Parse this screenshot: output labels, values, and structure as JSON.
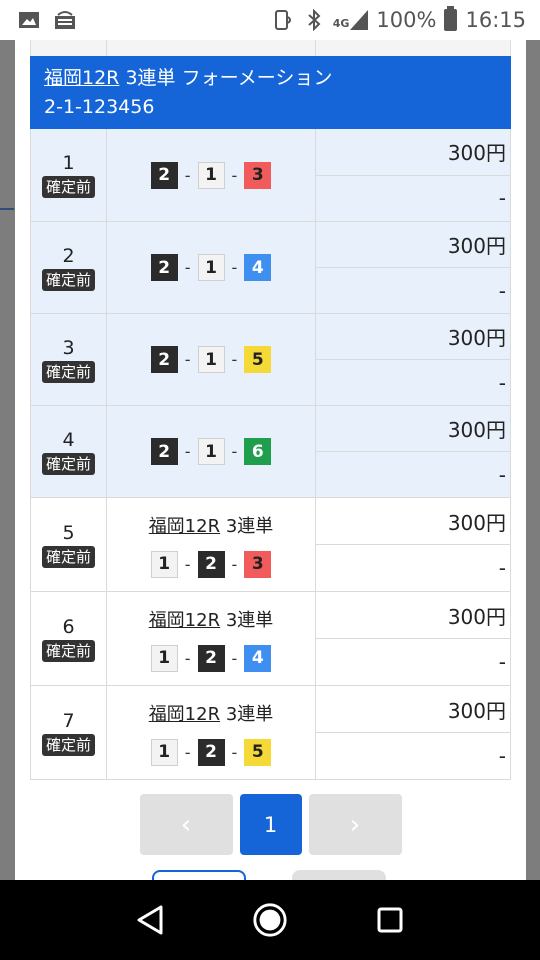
{
  "status_bar": {
    "network_label": "4G",
    "battery_text": "100%",
    "time": "16:15"
  },
  "banner": {
    "race": "福岡12R",
    "bet_type": "3連単 フォーメーション",
    "numbers": "2-1-123456"
  },
  "rows": [
    {
      "no": "1",
      "status": "確定前",
      "combo": [
        "2",
        "1",
        "3"
      ],
      "colors": [
        "black",
        "white",
        "red"
      ],
      "amount": "300円",
      "payout": "-"
    },
    {
      "no": "2",
      "status": "確定前",
      "combo": [
        "2",
        "1",
        "4"
      ],
      "colors": [
        "black",
        "white",
        "blue"
      ],
      "amount": "300円",
      "payout": "-"
    },
    {
      "no": "3",
      "status": "確定前",
      "combo": [
        "2",
        "1",
        "5"
      ],
      "colors": [
        "black",
        "white",
        "yellow"
      ],
      "amount": "300円",
      "payout": "-"
    },
    {
      "no": "4",
      "status": "確定前",
      "combo": [
        "2",
        "1",
        "6"
      ],
      "colors": [
        "black",
        "white",
        "green"
      ],
      "amount": "300円",
      "payout": "-"
    },
    {
      "no": "5",
      "status": "確定前",
      "race": "福岡12R",
      "bet_type": "3連単",
      "combo": [
        "1",
        "2",
        "3"
      ],
      "colors": [
        "white",
        "black",
        "red"
      ],
      "amount": "300円",
      "payout": "-"
    },
    {
      "no": "6",
      "status": "確定前",
      "race": "福岡12R",
      "bet_type": "3連単",
      "combo": [
        "1",
        "2",
        "4"
      ],
      "colors": [
        "white",
        "black",
        "blue"
      ],
      "amount": "300円",
      "payout": "-"
    },
    {
      "no": "7",
      "status": "確定前",
      "race": "福岡12R",
      "bet_type": "3連単",
      "combo": [
        "1",
        "2",
        "5"
      ],
      "colors": [
        "white",
        "black",
        "yellow"
      ],
      "amount": "300円",
      "payout": "-"
    }
  ],
  "pagination": {
    "prev_label": "‹",
    "current_page": "1",
    "next_label": "›"
  },
  "colors": {
    "accent": "#1565d8",
    "highlight_row": "#e8f0fb"
  }
}
